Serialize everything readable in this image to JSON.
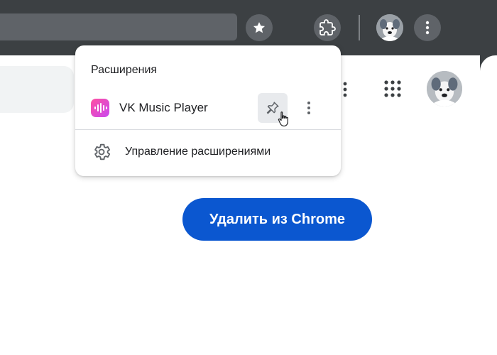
{
  "toolbar": {
    "star_icon": "star-icon",
    "extensions_icon": "puzzle-piece-icon",
    "menu_icon": "three-dots-vertical-icon"
  },
  "page": {
    "remove_button_label": "Удалить из Chrome",
    "apps_icon": "apps-grid-icon"
  },
  "extensions_popup": {
    "title": "Расширения",
    "items": [
      {
        "name": "VK Music Player",
        "icon": "vk-music-icon",
        "pin_icon": "pin-icon",
        "more_icon": "three-dots-vertical-icon"
      }
    ],
    "manage_label": "Управление расширениями",
    "manage_icon": "gear-icon"
  },
  "colors": {
    "toolbar_bg": "#3c4043",
    "button_bg": "#5f6368",
    "accent_blue": "#0b57d0",
    "vk_icon_pink": "#ff4fa1",
    "vk_icon_purple": "#c948f0"
  }
}
